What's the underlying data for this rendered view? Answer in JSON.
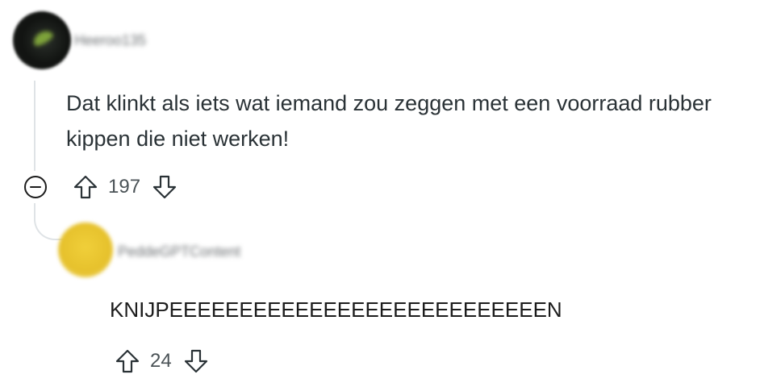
{
  "comment": {
    "username": "Heeroo135",
    "body": "Dat klinkt als iets wat iemand zou zeggen met een voorraad rubber kippen die niet werken!",
    "score": "197"
  },
  "reply": {
    "username": "PeddeGPTContent",
    "body": "KNIJPEEEEEEEEEEEEEEEEEEEEEEEEEEEN",
    "score": "24"
  },
  "icons": {
    "collapse": "minus-circle-icon",
    "upvote": "arrow-up-outline-icon",
    "downvote": "arrow-down-outline-icon"
  },
  "colors": {
    "text": "#2a3236",
    "muted": "#4a5256",
    "thread_line": "#dfe3e6"
  }
}
